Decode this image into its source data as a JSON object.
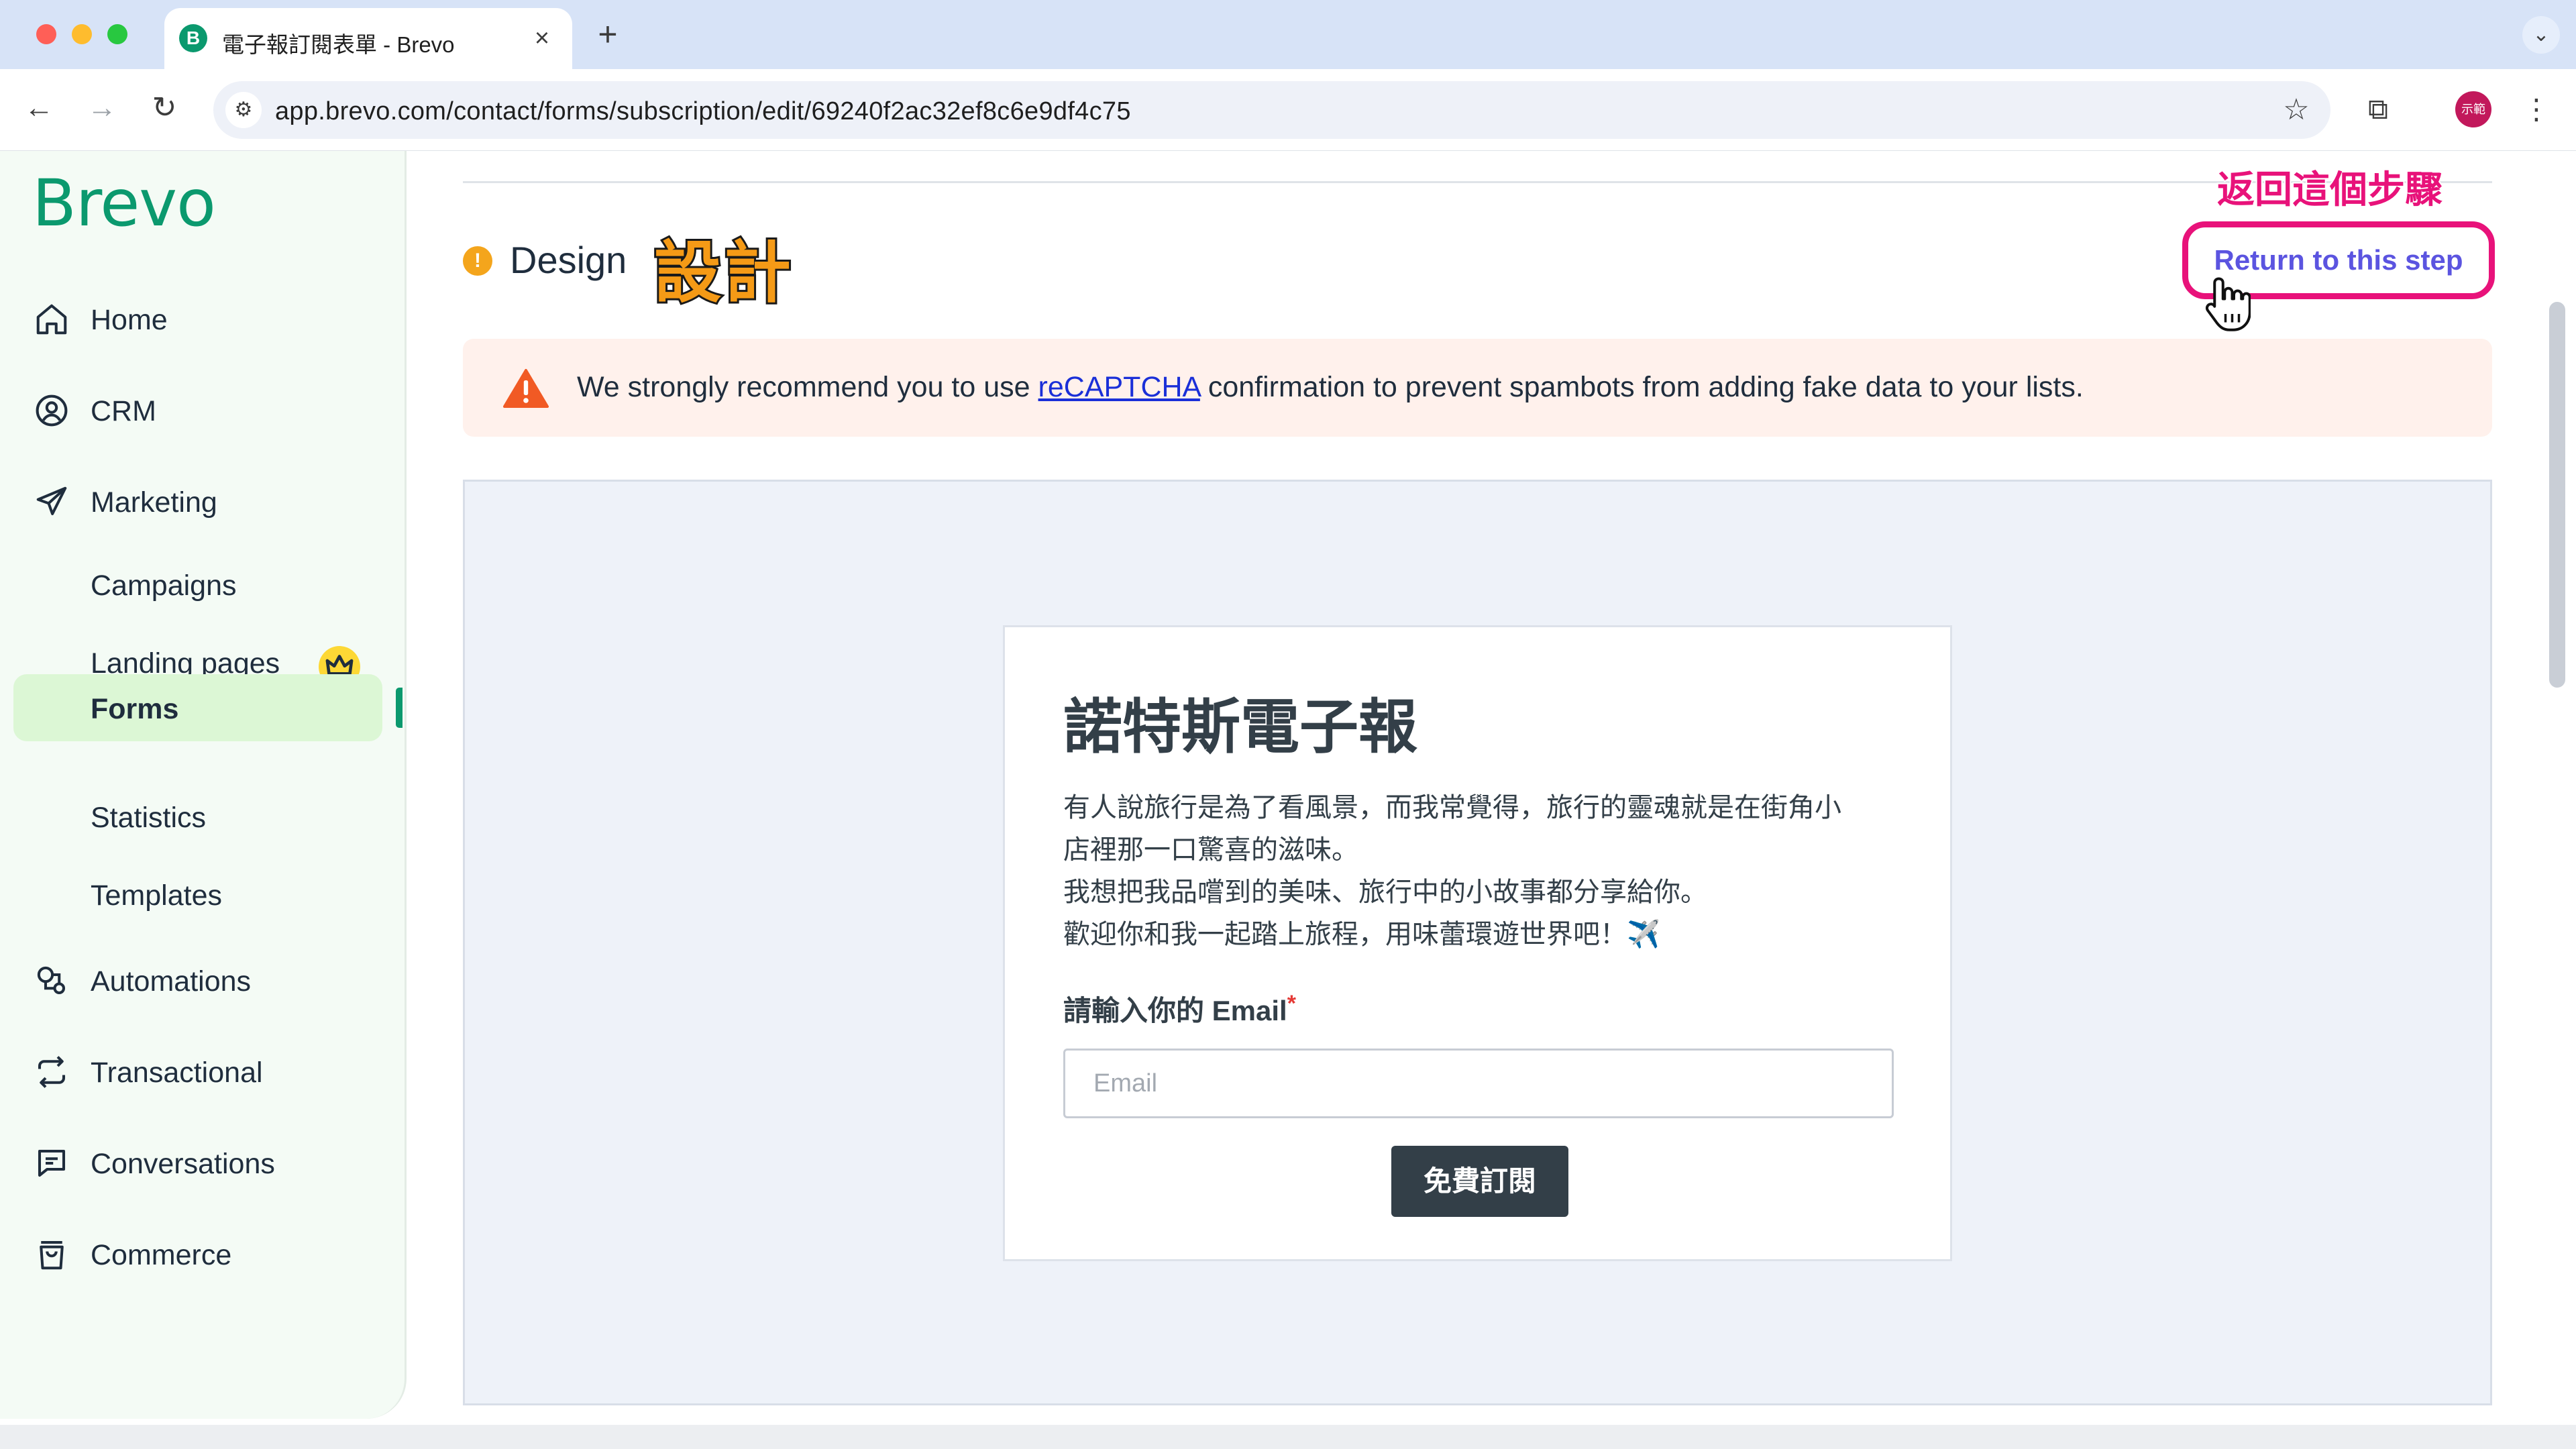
{
  "browser": {
    "tab_title": "電子報訂閱表單 - Brevo",
    "tab_favicon_letter": "B",
    "url": "app.brevo.com/contact/forms/subscription/edit/69240f2ac32ef8c6e9df4c75",
    "avatar_text": "示範"
  },
  "sidebar": {
    "logo": "Brevo",
    "items": [
      {
        "label": "Home",
        "icon": "home-icon"
      },
      {
        "label": "CRM",
        "icon": "contact-circle-icon"
      },
      {
        "label": "Marketing",
        "icon": "paper-plane-icon"
      },
      {
        "label": "Automations",
        "icon": "automation-icon"
      },
      {
        "label": "Transactional",
        "icon": "repeat-arrows-icon"
      },
      {
        "label": "Conversations",
        "icon": "chat-bubble-icon"
      },
      {
        "label": "Commerce",
        "icon": "shopping-bag-icon"
      }
    ],
    "marketing_sub": [
      {
        "label": "Campaigns"
      },
      {
        "label": "Landing pages",
        "badge": "crown-icon"
      },
      {
        "label": "Forms",
        "active": true
      },
      {
        "label": "Statistics"
      },
      {
        "label": "Templates"
      }
    ]
  },
  "main": {
    "step_title": "Design",
    "step_status_icon": "!",
    "annotation_design": "設計",
    "annotation_return": "返回這個步驟",
    "return_button": "Return to this step",
    "alert": {
      "prefix": "We strongly recommend you to use ",
      "link": "reCAPTCHA",
      "suffix": " confirmation to prevent spambots from adding fake data to your lists."
    },
    "form": {
      "title": "諾特斯電子報",
      "desc_lines": [
        "有人說旅行是為了看風景，而我常覺得，旅行的靈魂就是在街角小",
        "店裡那一口驚喜的滋味。",
        "我想把我品嚐到的美味、旅行中的小故事都分享給你。",
        "歡迎你和我一起踏上旅程，用味蕾環遊世界吧！✈️"
      ],
      "email_label": "請輸入你的 Email",
      "required_mark": "*",
      "email_placeholder": "Email",
      "submit": "免費訂閱"
    }
  },
  "colors": {
    "brand_green": "#0b996e",
    "active_nav_bg": "#dcf7d5",
    "annotation_pink": "#e8127a",
    "annotation_orange": "#f59a16",
    "return_text": "#5b54e0",
    "alert_bg": "#fff1ec",
    "warning_orange": "#f15a24",
    "form_button": "#333f48"
  }
}
